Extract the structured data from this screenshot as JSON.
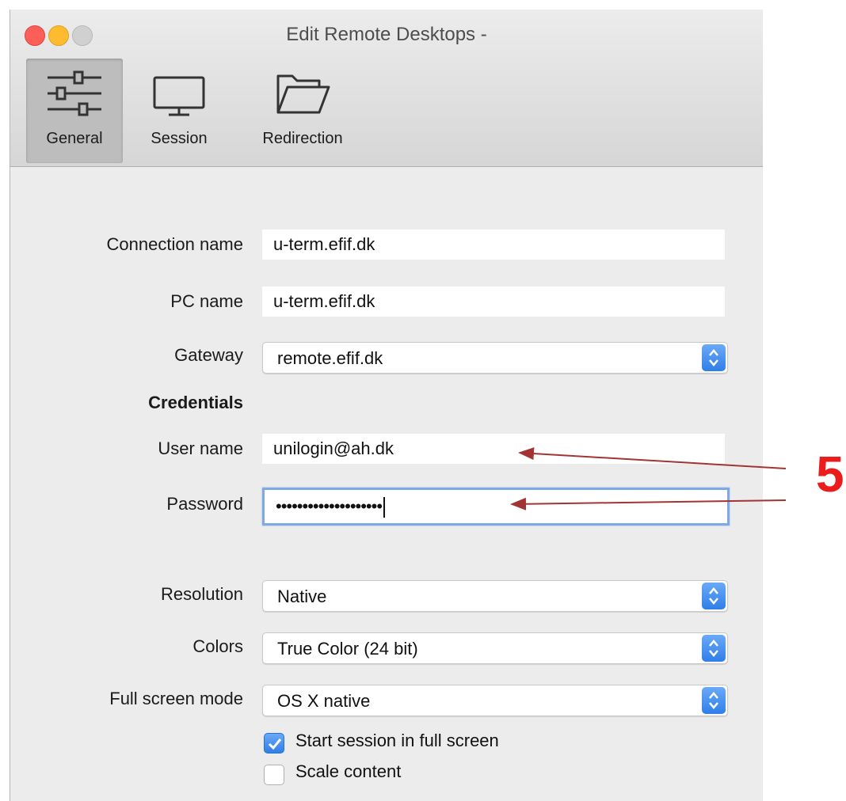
{
  "window": {
    "title": "Edit Remote Desktops -"
  },
  "toolbar": {
    "items": [
      {
        "label": "General",
        "icon": "sliders-icon",
        "selected": true
      },
      {
        "label": "Session",
        "icon": "monitor-icon",
        "selected": false
      },
      {
        "label": "Redirection",
        "icon": "folder-icon",
        "selected": false
      }
    ]
  },
  "form": {
    "connection_name": {
      "label": "Connection name",
      "value": "u-term.efif.dk"
    },
    "pc_name": {
      "label": "PC name",
      "value": "u-term.efif.dk"
    },
    "gateway": {
      "label": "Gateway",
      "value": "remote.efif.dk"
    },
    "credentials_heading": "Credentials",
    "user_name": {
      "label": "User name",
      "value": "unilogin@ah.dk"
    },
    "password": {
      "label": "Password",
      "value": "••••••••••••••••••••"
    },
    "resolution": {
      "label": "Resolution",
      "value": "Native"
    },
    "colors": {
      "label": "Colors",
      "value": "True Color (24 bit)"
    },
    "full_screen_mode": {
      "label": "Full screen mode",
      "value": "OS X native"
    },
    "start_full_screen": {
      "label": "Start session in full screen",
      "checked": true
    },
    "scale_content": {
      "label": "Scale content",
      "checked": false
    }
  },
  "annotation": {
    "number": "5",
    "color": "#ea1c1c",
    "arrow_color": "#a33434"
  },
  "colors": {
    "accent": "#3b82f0",
    "focus_ring": "#7fa9e2"
  }
}
